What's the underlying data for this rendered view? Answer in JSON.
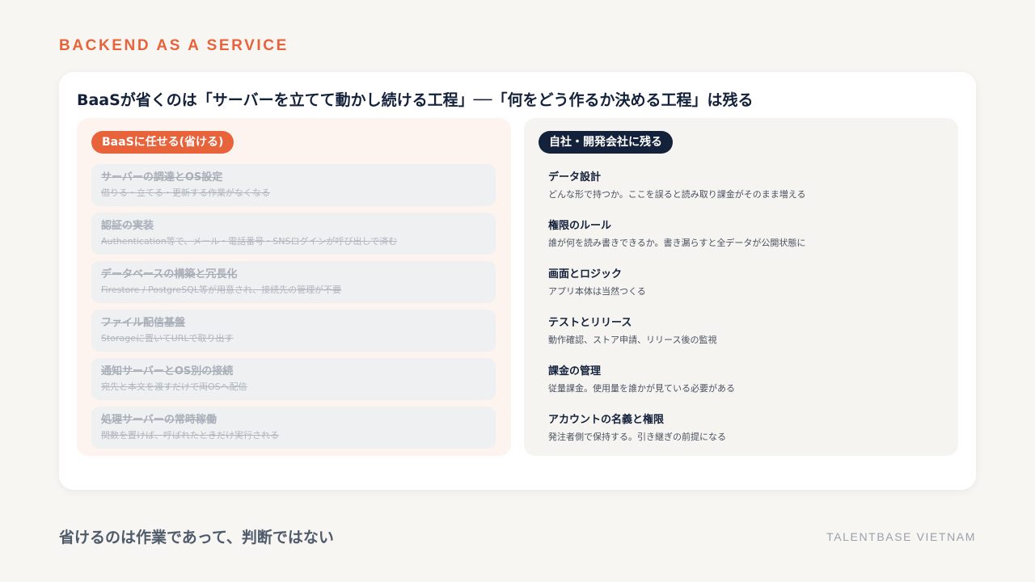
{
  "eyebrow": "BACKEND AS A SERVICE",
  "headline": "BaaSが省くのは「サーバーを立てて動かし続ける工程」──「何をどう作るか決める工程」は残る",
  "left_panel": {
    "pill": "BaaSに任せる(省ける)",
    "items": [
      {
        "title": "サーバーの調達とOS設定",
        "desc": "借りる・立てる・更新する作業がなくなる"
      },
      {
        "title": "認証の実装",
        "desc": "Authentication等で、メール・電話番号・SNSログインが呼び出しで済む"
      },
      {
        "title": "データベースの構築と冗長化",
        "desc": "Firestore / PostgreSQL等が用意され、接続先の管理が不要"
      },
      {
        "title": "ファイル配信基盤",
        "desc": "Storageに置いてURLで取り出す"
      },
      {
        "title": "通知サーバーとOS別の接続",
        "desc": "宛先と本文を渡すだけで両OSへ配信"
      },
      {
        "title": "処理サーバーの常時稼働",
        "desc": "関数を置けば、呼ばれたときだけ実行される"
      }
    ]
  },
  "right_panel": {
    "pill": "自社・開発会社に残る",
    "items": [
      {
        "title": "データ設計",
        "desc": "どんな形で持つか。ここを誤ると読み取り課金がそのまま増える"
      },
      {
        "title": "権限のルール",
        "desc": "誰が何を読み書きできるか。書き漏らすと全データが公開状態に"
      },
      {
        "title": "画面とロジック",
        "desc": "アプリ本体は当然つくる"
      },
      {
        "title": "テストとリリース",
        "desc": "動作確認、ストア申請、リリース後の監視"
      },
      {
        "title": "課金の管理",
        "desc": "従量課金。使用量を誰かが見ている必要がある"
      },
      {
        "title": "アカウントの名義と権限",
        "desc": "発注者側で保持する。引き継ぎの前提になる"
      }
    ]
  },
  "footer": {
    "message": "省けるのは作業であって、判断ではない",
    "brand": "TALENTBASE VIETNAM"
  },
  "colors": {
    "accent": "#e8623a",
    "navy": "#14213a",
    "background": "#f7f6f3"
  }
}
